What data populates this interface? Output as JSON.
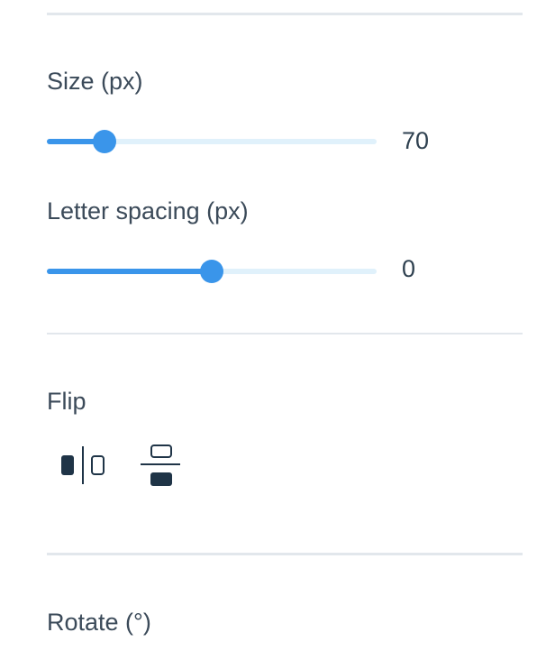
{
  "size": {
    "label": "Size (px)",
    "value": "70",
    "fraction": 0.175
  },
  "letter_spacing": {
    "label": "Letter spacing (px)",
    "value": "0",
    "fraction": 0.5
  },
  "flip": {
    "label": "Flip",
    "horizontal_icon": "flip-horizontal-icon",
    "vertical_icon": "flip-vertical-icon"
  },
  "rotate": {
    "label": "Rotate (°)"
  },
  "colors": {
    "accent": "#3a95ea",
    "track": "#e0f1fb",
    "divider": "#e2e7ec",
    "text": "#3b4a59",
    "icon": "#1f3447"
  }
}
